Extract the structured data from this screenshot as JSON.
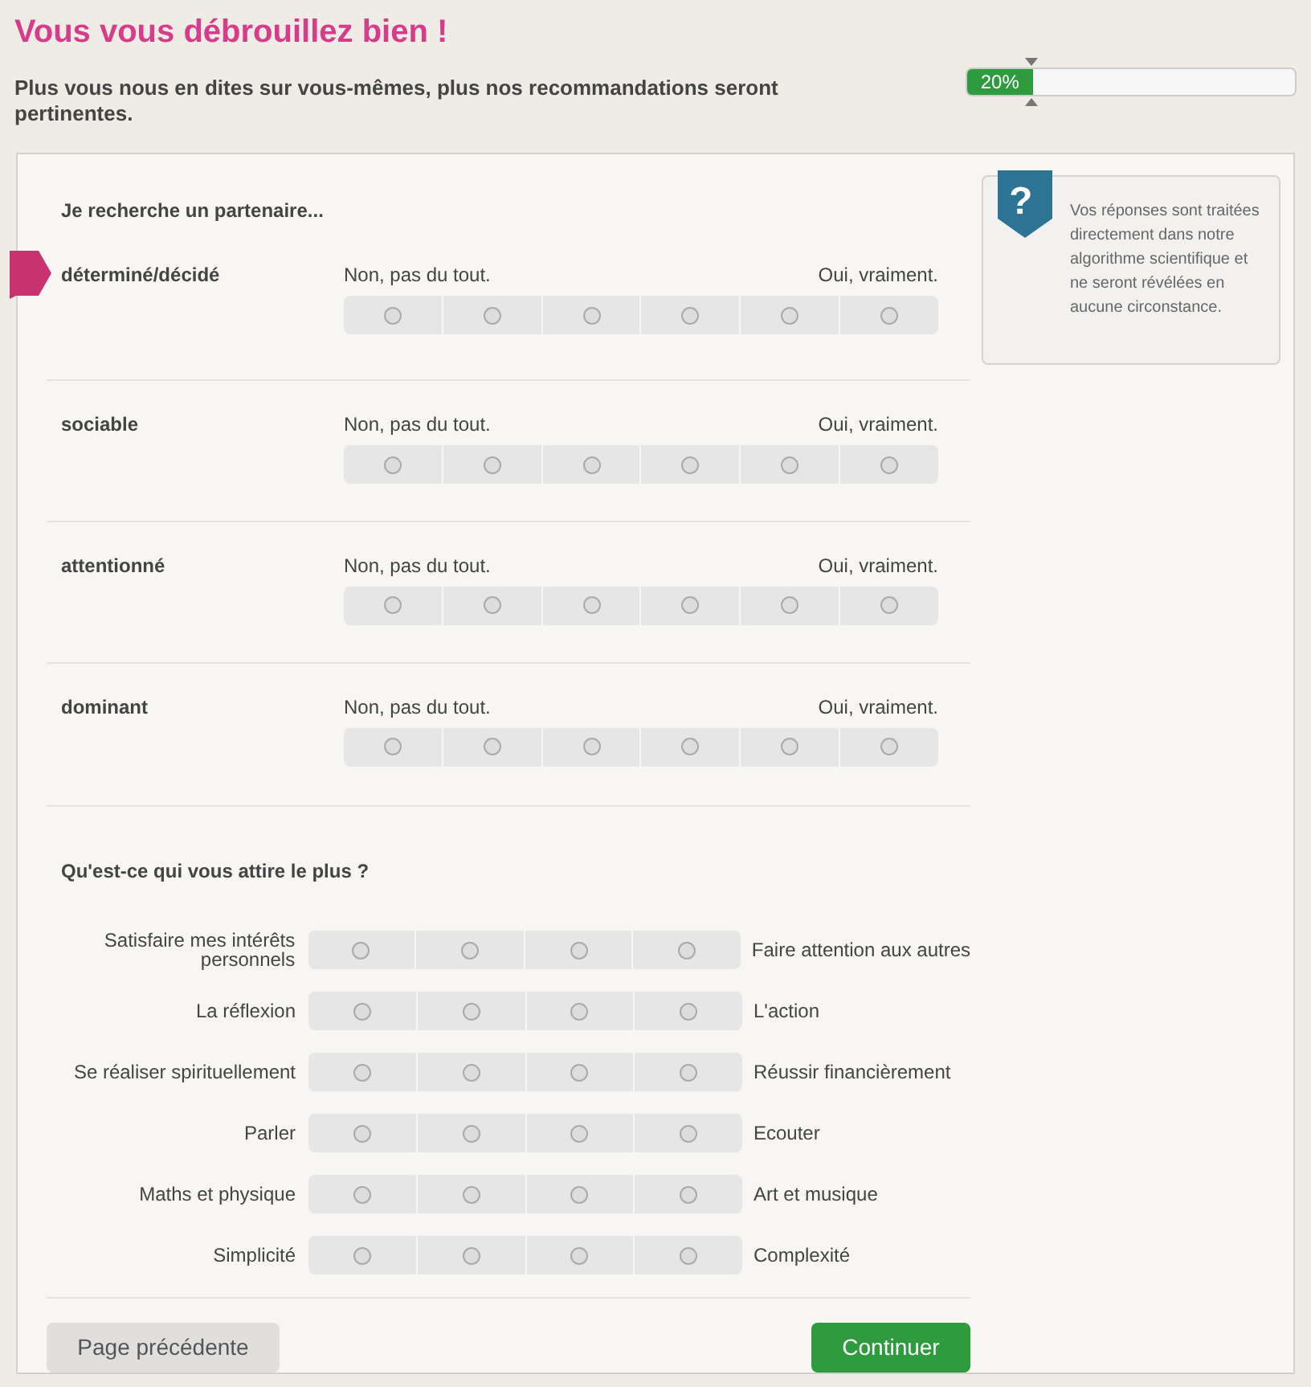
{
  "title": "Vous vous débrouillez bien !",
  "subtitle": "Plus vous nous en dites sur vous-mêmes, plus nos recommandations seront pertinentes.",
  "progress": {
    "label": "20%",
    "level": 0.2
  },
  "help": {
    "icon": "?",
    "text": "Vos réponses sont traitées directement dans notre algorithme scientifique et ne seront révélées en aucune circonstance."
  },
  "traits_section": {
    "heading": "Je recherche un partenaire...",
    "traits": [
      {
        "name": "déterminé/décidé",
        "low_label": "Non, pas du tout.",
        "high_label": "Oui, vraiment.",
        "current": true,
        "options": [
          {
            "selected": false
          },
          {
            "selected": false
          },
          {
            "selected": false
          },
          {
            "selected": false
          },
          {
            "selected": false
          },
          {
            "selected": false
          }
        ]
      },
      {
        "name": "sociable",
        "low_label": "Non, pas du tout.",
        "high_label": "Oui, vraiment.",
        "current": false,
        "options": [
          {
            "selected": false
          },
          {
            "selected": false
          },
          {
            "selected": false
          },
          {
            "selected": false
          },
          {
            "selected": false
          },
          {
            "selected": false
          }
        ]
      },
      {
        "name": "attentionné",
        "low_label": "Non, pas du tout.",
        "high_label": "Oui, vraiment.",
        "current": false,
        "options": [
          {
            "selected": false
          },
          {
            "selected": false
          },
          {
            "selected": false
          },
          {
            "selected": false
          },
          {
            "selected": false
          },
          {
            "selected": false
          }
        ]
      },
      {
        "name": "dominant",
        "low_label": "Non, pas du tout.",
        "high_label": "Oui, vraiment.",
        "current": false,
        "options": [
          {
            "selected": false
          },
          {
            "selected": false
          },
          {
            "selected": false
          },
          {
            "selected": false
          },
          {
            "selected": false
          },
          {
            "selected": false
          }
        ]
      }
    ]
  },
  "pairs_section": {
    "heading": "Qu'est-ce qui vous attire le plus ?",
    "pairs": [
      {
        "left": "Satisfaire mes intérêts personnels",
        "right": "Faire attention aux autres",
        "options": [
          {
            "selected": false
          },
          {
            "selected": false
          },
          {
            "selected": false
          },
          {
            "selected": false
          }
        ]
      },
      {
        "left": "La réflexion",
        "right": "L'action",
        "options": [
          {
            "selected": false
          },
          {
            "selected": false
          },
          {
            "selected": false
          },
          {
            "selected": false
          }
        ]
      },
      {
        "left": "Se réaliser spirituellement",
        "right": "Réussir financièrement",
        "options": [
          {
            "selected": false
          },
          {
            "selected": false
          },
          {
            "selected": false
          },
          {
            "selected": false
          }
        ]
      },
      {
        "left": "Parler",
        "right": "Ecouter",
        "options": [
          {
            "selected": false
          },
          {
            "selected": false
          },
          {
            "selected": false
          },
          {
            "selected": false
          }
        ]
      },
      {
        "left": "Maths et physique",
        "right": "Art et musique",
        "options": [
          {
            "selected": false
          },
          {
            "selected": false
          },
          {
            "selected": false
          },
          {
            "selected": false
          }
        ]
      },
      {
        "left": "Simplicité",
        "right": "Complexité",
        "options": [
          {
            "selected": false
          },
          {
            "selected": false
          },
          {
            "selected": false
          },
          {
            "selected": false
          }
        ]
      }
    ]
  },
  "buttons": {
    "back": "Page précédente",
    "next": "Continuer"
  }
}
